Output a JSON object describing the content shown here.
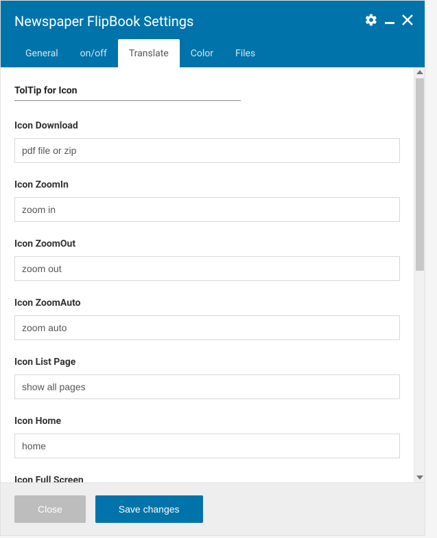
{
  "title": "Newspaper FlipBook Settings",
  "tabs": {
    "general": "General",
    "onoff": "on/off",
    "translate": "Translate",
    "color": "Color",
    "files": "Files"
  },
  "section_title": "TolTip for Icon",
  "fields": {
    "download": {
      "label": "Icon Download",
      "value": "pdf file or zip"
    },
    "zoomin": {
      "label": "Icon ZoomIn",
      "value": "zoom in"
    },
    "zoomout": {
      "label": "Icon ZoomOut",
      "value": "zoom out"
    },
    "zoomauto": {
      "label": "Icon ZoomAuto",
      "value": "zoom auto"
    },
    "listpage": {
      "label": "Icon List Page",
      "value": "show all pages"
    },
    "home": {
      "label": "Icon Home",
      "value": "home"
    },
    "fullscreen": {
      "label": "Icon Full Screen"
    }
  },
  "footer": {
    "close": "Close",
    "save": "Save changes"
  }
}
